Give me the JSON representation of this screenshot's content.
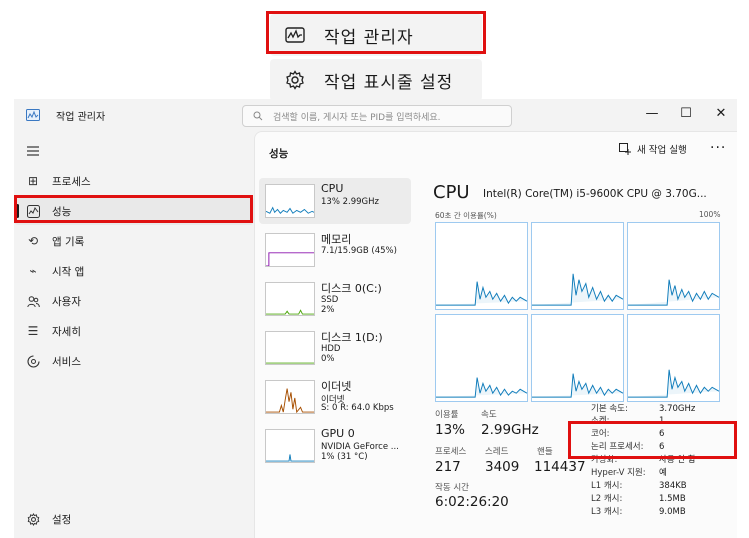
{
  "context_menu": {
    "items": [
      {
        "label": "작업 관리자",
        "icon": "task-manager-icon"
      },
      {
        "label": "작업 표시줄 설정",
        "icon": "gear-icon"
      }
    ]
  },
  "window": {
    "title": "작업 관리자",
    "search_placeholder": "검색할 이름, 게시자 또는 PID를 입력하세요.",
    "controls": {
      "minimize": "—",
      "maximize": "☐",
      "close": "✕"
    }
  },
  "sidebar": {
    "items": [
      {
        "label": "프로세스",
        "icon": "processes-icon",
        "glyph": "⊞"
      },
      {
        "label": "성능",
        "icon": "performance-icon",
        "glyph": "📈"
      },
      {
        "label": "앱 기록",
        "icon": "history-icon",
        "glyph": "⟲"
      },
      {
        "label": "시작 앱",
        "icon": "startup-icon",
        "glyph": "⌁"
      },
      {
        "label": "사용자",
        "icon": "users-icon",
        "glyph": "👥"
      },
      {
        "label": "자세히",
        "icon": "details-icon",
        "glyph": "☰"
      },
      {
        "label": "서비스",
        "icon": "services-icon",
        "glyph": "⚙"
      }
    ],
    "settings_label": "설정"
  },
  "main": {
    "title": "성능",
    "new_task_label": "새 작업 실행",
    "more": "···"
  },
  "resources": [
    {
      "name": "CPU",
      "line1": "13% 2.99GHz",
      "line2": ""
    },
    {
      "name": "메모리",
      "line1": "7.1/15.9GB (45%)",
      "line2": ""
    },
    {
      "name": "디스크 0(C:)",
      "line1": "SSD",
      "line2": "2%"
    },
    {
      "name": "디스크 1(D:)",
      "line1": "HDD",
      "line2": "0%"
    },
    {
      "name": "이더넷",
      "line1": "이더넷",
      "line2": "S: 0 R: 64.0 Kbps"
    },
    {
      "name": "GPU 0",
      "line1": "NVIDIA GeForce ...",
      "line2": "1% (31 °C)"
    }
  ],
  "detail": {
    "title": "CPU",
    "model": "Intel(R) Core(TM) i5-9600K CPU @ 3.70G...",
    "util_label": "60초 간 이용률(%)",
    "util_max": "100%",
    "stats": {
      "usage_label": "이용률",
      "usage": "13%",
      "speed_label": "속도",
      "speed": "2.99GHz",
      "processes_label": "프로세스",
      "processes": "217",
      "threads_label": "스레드",
      "threads": "3409",
      "handles_label": "핸들",
      "handles": "114437",
      "uptime_label": "작동 시간",
      "uptime": "6:02:26:20"
    },
    "info": [
      {
        "k": "기본 속도:",
        "v": "3.70GHz"
      },
      {
        "k": "소켓:",
        "v": "1"
      },
      {
        "k": "코어:",
        "v": "6"
      },
      {
        "k": "논리 프로세서:",
        "v": "6"
      },
      {
        "k": "가상화:",
        "v": "사용 안 함"
      },
      {
        "k": "Hyper-V 지원:",
        "v": "예"
      },
      {
        "k": "L1 캐시:",
        "v": "384KB"
      },
      {
        "k": "L2 캐시:",
        "v": "1.5MB"
      },
      {
        "k": "L3 캐시:",
        "v": "9.0MB"
      }
    ]
  },
  "colors": {
    "highlight": "#e01010",
    "cpu": "#117dbb",
    "memory": "#8b12ae",
    "disk": "#4da60c",
    "ethernet": "#a74f01"
  }
}
